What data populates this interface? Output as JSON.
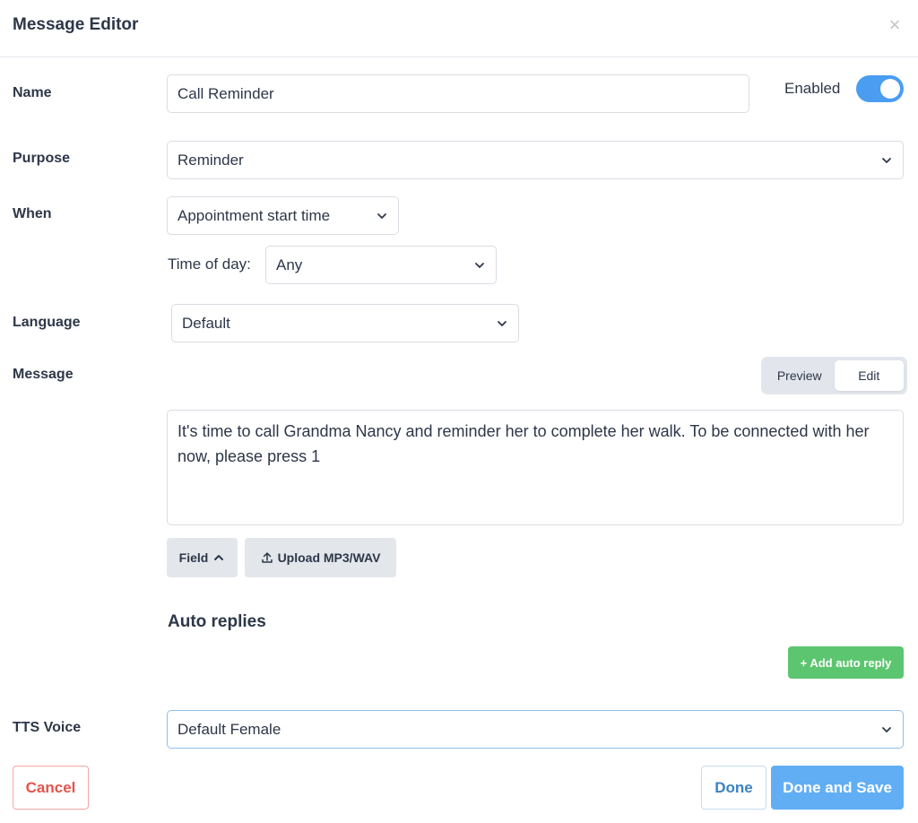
{
  "modal": {
    "title": "Message Editor",
    "close_icon": "×"
  },
  "name": {
    "label": "Name",
    "value": "Call Reminder"
  },
  "enabled": {
    "label": "Enabled",
    "on": true
  },
  "purpose": {
    "label": "Purpose",
    "value": "Reminder"
  },
  "when": {
    "label": "When",
    "value": "Appointment start time"
  },
  "time_of_day": {
    "label": "Time of day:",
    "value": "Any"
  },
  "language": {
    "label": "Language",
    "value": "Default"
  },
  "message": {
    "label": "Message",
    "tabs": {
      "preview": "Preview",
      "edit": "Edit",
      "active": "edit"
    },
    "body": "It's time to call Grandma Nancy and reminder her to complete her walk. To be connected with her now, please press 1",
    "field_button": "Field",
    "upload_button": "Upload MP3/WAV"
  },
  "auto_replies": {
    "title": "Auto replies",
    "add_button": "+ Add auto reply"
  },
  "tts_voice": {
    "label": "TTS Voice",
    "value": "Default Female"
  },
  "footer": {
    "cancel": "Cancel",
    "done": "Done",
    "done_and_save": "Done and Save"
  },
  "colors": {
    "toggle_on": "#4a9df0",
    "cancel": "#e5534b",
    "done": "#3b82c4",
    "primary": "#62aef4",
    "add": "#5cc56f"
  }
}
